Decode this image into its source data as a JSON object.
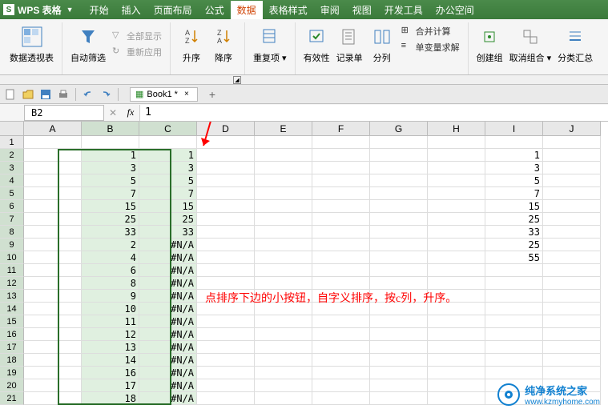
{
  "titlebar": {
    "app": "WPS 表格"
  },
  "tabs": [
    "开始",
    "插入",
    "页面布局",
    "公式",
    "数据",
    "表格样式",
    "审阅",
    "视图",
    "开发工具",
    "办公空间"
  ],
  "active_tab_index": 4,
  "ribbon": {
    "pivot": "数据透视表",
    "autofilter": "自动筛选",
    "show_all": "全部显示",
    "reapply": "重新应用",
    "sort_asc": "升序",
    "sort_desc": "降序",
    "duplicates": "重复项",
    "validation": "有效性",
    "form": "记录单",
    "text_to_cols": "分列",
    "consolidate": "合并计算",
    "solver": "单变量求解",
    "group": "创建组",
    "ungroup": "取消组合",
    "subtotal": "分类汇总"
  },
  "document": {
    "name": "Book1",
    "modified": "*"
  },
  "formula_bar": {
    "cell_ref": "B2",
    "value": "1"
  },
  "columns": [
    "A",
    "B",
    "C",
    "D",
    "E",
    "F",
    "G",
    "H",
    "I",
    "J"
  ],
  "selected_cols": [
    1,
    2
  ],
  "rows": 21,
  "selected_rows_start": 2,
  "data_b": [
    "",
    "1",
    "3",
    "5",
    "7",
    "15",
    "25",
    "33",
    "2",
    "4",
    "6",
    "8",
    "9",
    "10",
    "11",
    "12",
    "13",
    "14",
    "16",
    "17",
    "18"
  ],
  "data_c": [
    "",
    "1",
    "3",
    "5",
    "7",
    "15",
    "25",
    "33",
    "#N/A",
    "#N/A",
    "#N/A",
    "#N/A",
    "#N/A",
    "#N/A",
    "#N/A",
    "#N/A",
    "#N/A",
    "#N/A",
    "#N/A",
    "#N/A",
    "#N/A"
  ],
  "data_i": [
    "",
    "1",
    "3",
    "5",
    "7",
    "15",
    "25",
    "33",
    "25",
    "55",
    "",
    "",
    "",
    "",
    "",
    "",
    "",
    "",
    "",
    "",
    ""
  ],
  "annotation_text": "点排序下边的小按钮，自字义排序，按c列，升序。",
  "watermark": {
    "name": "纯净系统之家",
    "url": "www.kzmyhome.com"
  }
}
